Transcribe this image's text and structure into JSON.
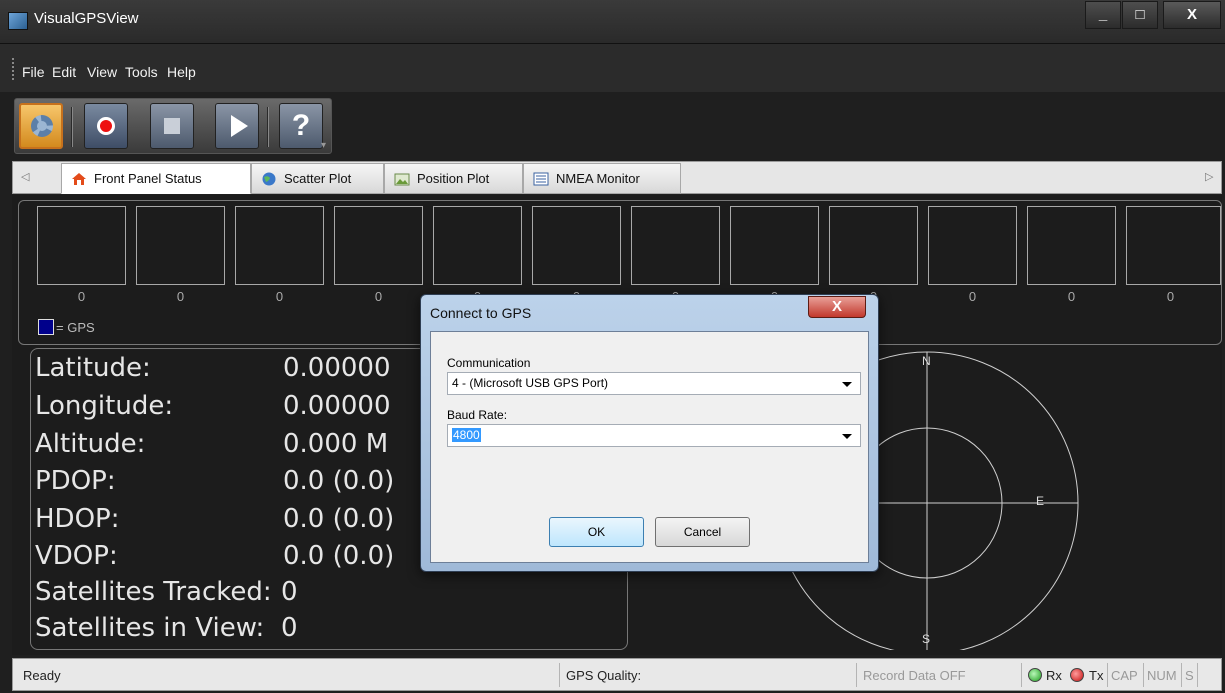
{
  "window": {
    "title": "VisualGPSView"
  },
  "menu": {
    "items": [
      "File",
      "Edit",
      "View",
      "Tools",
      "Help"
    ]
  },
  "toolbar": {
    "help_label": "?"
  },
  "tabs": [
    {
      "label": "Front Panel Status",
      "active": true
    },
    {
      "label": "Scatter Plot",
      "active": false
    },
    {
      "label": "Position Plot",
      "active": false
    },
    {
      "label": "NMEA Monitor",
      "active": false
    }
  ],
  "satellites": {
    "values": [
      "0",
      "0",
      "0",
      "0",
      "0",
      "0",
      "0",
      "0",
      "0",
      "0",
      "0",
      "0"
    ],
    "legend_label": "= GPS",
    "legend_color": "#00008b"
  },
  "status": {
    "rows": [
      {
        "label": "Latitude:",
        "value": "0.00000"
      },
      {
        "label": "Longitude:",
        "value": "0.00000"
      },
      {
        "label": "Altitude:",
        "value": "0.000 M"
      },
      {
        "label": "PDOP:",
        "value": "0.0 (0.0)"
      },
      {
        "label": "HDOP:",
        "value": "0.0 (0.0)"
      },
      {
        "label": "VDOP:",
        "value": "0.0 (0.0)"
      },
      {
        "label": "Satellites Tracked:",
        "value": "0"
      },
      {
        "label": "Satellites in View:",
        "value": "0"
      }
    ]
  },
  "compass": {
    "north": "N",
    "east": "E",
    "south": "S"
  },
  "dialog": {
    "title": "Connect to GPS",
    "close_label": "X",
    "communication_label": "Communication",
    "communication_value": "4 - (Microsoft USB GPS Port)",
    "baud_label": "Baud Rate:",
    "baud_value": "4800",
    "ok_label": "OK",
    "cancel_label": "Cancel"
  },
  "statusbar": {
    "ready": "Ready",
    "gps_quality": "GPS Quality:",
    "record": "Record Data OFF",
    "rx": "Rx",
    "tx": "Tx",
    "cap": "CAP",
    "num": "NUM",
    "scrl": "S"
  }
}
